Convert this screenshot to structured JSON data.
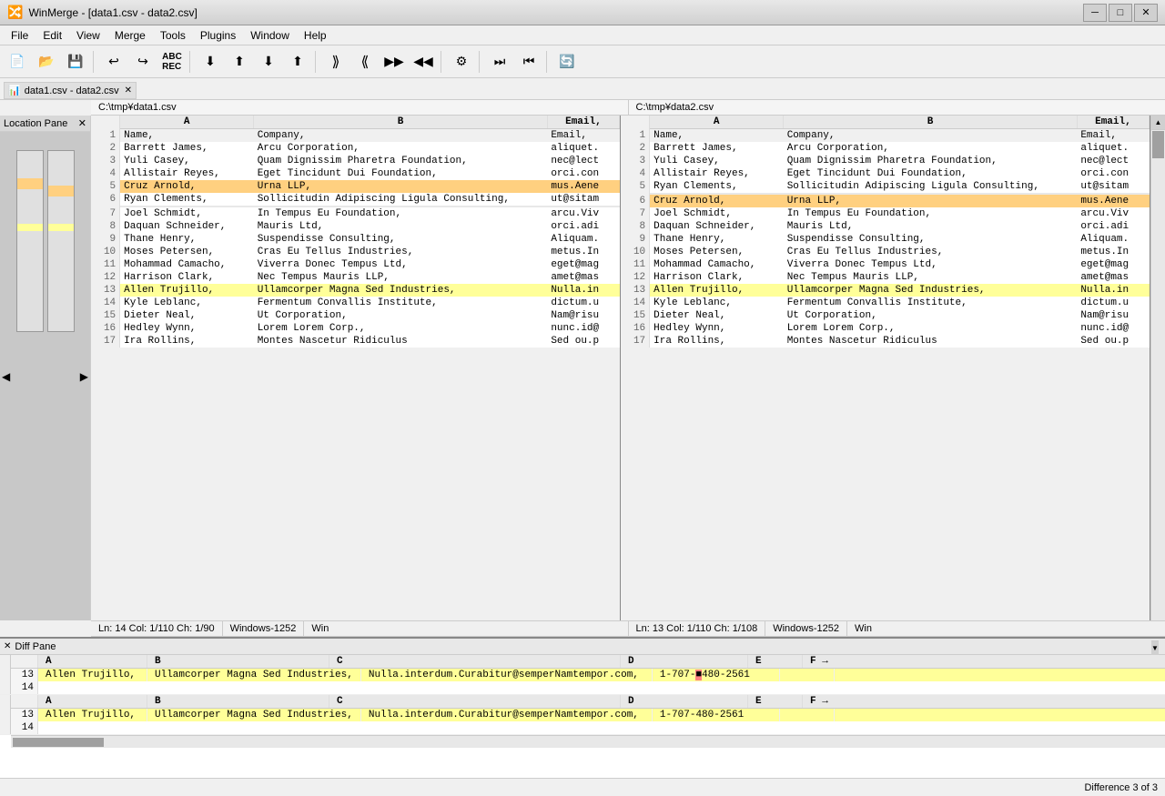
{
  "titlebar": {
    "title": "WinMerge - [data1.csv - data2.csv]",
    "icon": "winmerge-icon",
    "controls": {
      "minimize": "─",
      "maximize": "□",
      "close": "✕"
    }
  },
  "menubar": {
    "items": [
      "File",
      "Edit",
      "View",
      "Merge",
      "Tools",
      "Plugins",
      "Window",
      "Help"
    ]
  },
  "tabs": {
    "active": "data1.csv - data2.csv",
    "items": [
      "data1.csv - data2.csv"
    ]
  },
  "location_pane": {
    "label": "Location Pane",
    "close": "✕"
  },
  "file_headers": {
    "left": "C:\\tmp¥data1.csv",
    "right": "C:\\tmp¥data2.csv"
  },
  "left_pane": {
    "col_headers": [
      "A",
      "B",
      "Email,"
    ],
    "rows": [
      {
        "num": 1,
        "a": "Name,",
        "b": "Company,",
        "c": "Email,",
        "type": "header"
      },
      {
        "num": 2,
        "a": "Barrett James,",
        "b": "Arcu Corporation,",
        "c": "aliquet.",
        "type": "normal"
      },
      {
        "num": 3,
        "a": "Yuli Casey,",
        "b": "Quam Dignissim Pharetra Foundation,",
        "c": "nec@lect",
        "type": "normal"
      },
      {
        "num": 4,
        "a": "Allistair Reyes,",
        "b": "Eget Tincidunt Dui Foundation,",
        "c": "orci.con",
        "type": "normal"
      },
      {
        "num": 5,
        "a": "Cruz Arnold,",
        "b": "Urna LLP,",
        "c": "mus.Aene",
        "type": "diff_orange"
      },
      {
        "num": 6,
        "a": "Ryan Clements,",
        "b": "Sollicitudin Adipiscing Ligula Consulting,",
        "c": "ut@sitam",
        "type": "normal"
      },
      {
        "num": "",
        "a": "",
        "b": "",
        "c": "",
        "type": "empty"
      },
      {
        "num": 7,
        "a": "Joel Schmidt,",
        "b": "In Tempus Eu Foundation,",
        "c": "arcu.Viv",
        "type": "normal"
      },
      {
        "num": 8,
        "a": "Daquan Schneider,",
        "b": "Mauris Ltd,",
        "c": "orci.adi",
        "type": "normal"
      },
      {
        "num": 9,
        "a": "Thane Henry,",
        "b": "Suspendisse Consulting,",
        "c": "Aliquam.",
        "type": "normal"
      },
      {
        "num": 10,
        "a": "Moses Petersen,",
        "b": "Cras Eu Tellus Industries,",
        "c": "metus.In",
        "type": "normal"
      },
      {
        "num": 11,
        "a": "Mohammad Camacho,",
        "b": "Viverra Donec Tempus Ltd,",
        "c": "eget@mag",
        "type": "normal"
      },
      {
        "num": 12,
        "a": "Harrison Clark,",
        "b": "Nec Tempus Mauris LLP,",
        "c": "amet@mas",
        "type": "normal"
      },
      {
        "num": 13,
        "a": "Allen Trujillo,",
        "b": "Ullamcorper Magna Sed Industries,",
        "c": "Nulla.in",
        "type": "diff_yellow"
      },
      {
        "num": 14,
        "a": "Kyle Leblanc,",
        "b": "Fermentum Convallis Institute,",
        "c": "dictum.u",
        "type": "normal"
      },
      {
        "num": 15,
        "a": "Dieter Neal,",
        "b": "Ut Corporation,",
        "c": "Nam@risu",
        "type": "normal"
      },
      {
        "num": 16,
        "a": "Hedley Wynn,",
        "b": "Lorem Lorem Corp.,",
        "c": "nunc.id@",
        "type": "normal"
      },
      {
        "num": 17,
        "a": "Ira Rollins,",
        "b": "Montes Nascetur Ridiculus",
        "c": "Sed ou.p",
        "type": "normal"
      }
    ],
    "status": "Ln: 14  Col: 1/110  Ch: 1/90",
    "encoding": "Windows-1252",
    "eol": "Win"
  },
  "right_pane": {
    "rows": [
      {
        "num": 1,
        "a": "Name,",
        "b": "Company,",
        "c": "Email,",
        "type": "header"
      },
      {
        "num": 2,
        "a": "Barrett James,",
        "b": "Arcu Corporation,",
        "c": "aliquet.",
        "type": "normal"
      },
      {
        "num": 3,
        "a": "Yuli Casey,",
        "b": "Quam Dignissim Pharetra Foundation,",
        "c": "nec@lect",
        "type": "normal"
      },
      {
        "num": 4,
        "a": "Allistair Reyes,",
        "b": "Eget Tincidunt Dui Foundation,",
        "c": "orci.con",
        "type": "normal"
      },
      {
        "num": 5,
        "a": "Ryan Clements,",
        "b": "Sollicitudin Adipiscing Ligula Consulting,",
        "c": "ut@sitam",
        "type": "normal"
      },
      {
        "num": "",
        "a": "",
        "b": "",
        "c": "",
        "type": "empty"
      },
      {
        "num": 6,
        "a": "Cruz Arnold,",
        "b": "Urna LLP,",
        "c": "mus.Aene",
        "type": "diff_orange"
      },
      {
        "num": 7,
        "a": "Joel Schmidt,",
        "b": "In Tempus Eu Foundation,",
        "c": "arcu.Viv",
        "type": "normal"
      },
      {
        "num": 8,
        "a": "Daquan Schneider,",
        "b": "Mauris Ltd,",
        "c": "orci.adi",
        "type": "normal"
      },
      {
        "num": 9,
        "a": "Thane Henry,",
        "b": "Suspendisse Consulting,",
        "c": "Aliquam.",
        "type": "normal"
      },
      {
        "num": 10,
        "a": "Moses Petersen,",
        "b": "Cras Eu Tellus Industries,",
        "c": "metus.In",
        "type": "normal"
      },
      {
        "num": 11,
        "a": "Mohammad Camacho,",
        "b": "Viverra Donec Tempus Ltd,",
        "c": "eget@mag",
        "type": "normal"
      },
      {
        "num": 12,
        "a": "Harrison Clark,",
        "b": "Nec Tempus Mauris LLP,",
        "c": "amet@mas",
        "type": "normal"
      },
      {
        "num": 13,
        "a": "Allen Trujillo,",
        "b": "Ullamcorper Magna Sed Industries,",
        "c": "Nulla.in",
        "type": "diff_yellow"
      },
      {
        "num": 14,
        "a": "Kyle Leblanc,",
        "b": "Fermentum Convallis Institute,",
        "c": "dictum.u",
        "type": "normal"
      },
      {
        "num": 15,
        "a": "Dieter Neal,",
        "b": "Ut Corporation,",
        "c": "Nam@risu",
        "type": "normal"
      },
      {
        "num": 16,
        "a": "Hedley Wynn,",
        "b": "Lorem Lorem Corp.,",
        "c": "nunc.id@",
        "type": "normal"
      },
      {
        "num": 17,
        "a": "Ira Rollins,",
        "b": "Montes Nascetur Ridiculus",
        "c": "Sed ou.p",
        "type": "normal"
      }
    ],
    "status": "Ln: 13  Col: 1/110  Ch: 1/108",
    "encoding": "Windows-1252",
    "eol": "Win"
  },
  "bottom_diff": {
    "close": "✕",
    "label": "Diff Pane",
    "rows_top": [
      {
        "linenum": 13,
        "a": "Allen Trujillo,",
        "b": "Ullamcorper Magna Sed Industries,",
        "c": "Nulla.interdum.Curabitur@semperNamtempor.com,",
        "d": "1-707-■480-2561",
        "e": "",
        "f": ""
      },
      {
        "linenum": 14,
        "a": "",
        "b": "",
        "c": "",
        "d": "",
        "e": "",
        "f": ""
      }
    ],
    "rows_bottom": [
      {
        "linenum": 13,
        "a": "Allen Trujillo,",
        "b": "Ullamcorper Magna Sed Industries,",
        "c": "Nulla.interdum.Curabitur@semperNamtempor.com,",
        "d": "1-707-480-2561",
        "e": "",
        "f": ""
      },
      {
        "linenum": 14,
        "a": "",
        "b": "",
        "c": "",
        "d": "",
        "e": "",
        "f": ""
      }
    ],
    "col_headers_top": [
      "A",
      "B",
      "C",
      "D",
      "E",
      "F →"
    ],
    "col_headers_bottom": [
      "A",
      "B",
      "C",
      "D",
      "E",
      "F →"
    ]
  },
  "statusbar": {
    "right_text": "Difference 3 of 3"
  },
  "toolbar_buttons": [
    {
      "icon": "📄",
      "name": "new"
    },
    {
      "icon": "📂",
      "name": "open"
    },
    {
      "icon": "💾",
      "name": "save"
    },
    {
      "sep": true
    },
    {
      "icon": "↩",
      "name": "undo"
    },
    {
      "icon": "↪",
      "name": "redo"
    },
    {
      "icon": "📋",
      "name": "paste"
    },
    {
      "sep": true
    },
    {
      "icon": "⬇",
      "name": "next-diff"
    },
    {
      "icon": "⬆",
      "name": "prev-diff"
    },
    {
      "icon": "⬇",
      "name": "next-conflict"
    },
    {
      "icon": "⬆",
      "name": "prev-conflict"
    },
    {
      "sep": true
    },
    {
      "icon": "⟫",
      "name": "copy-right"
    },
    {
      "icon": "⟪",
      "name": "copy-left"
    },
    {
      "sep": true
    },
    {
      "icon": "⚙",
      "name": "options"
    },
    {
      "sep": true
    },
    {
      "icon": "⏭",
      "name": "first-diff"
    },
    {
      "icon": "⏮",
      "name": "last-diff"
    },
    {
      "sep": true
    },
    {
      "icon": "🔄",
      "name": "refresh"
    }
  ]
}
